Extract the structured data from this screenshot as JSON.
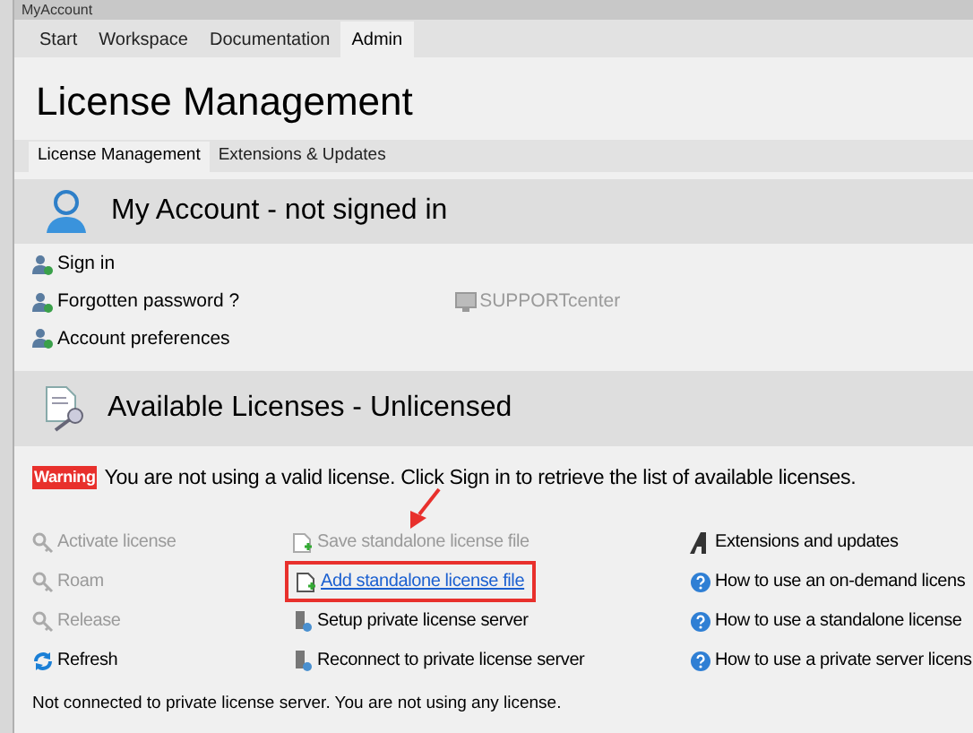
{
  "window": {
    "title": "MyAccount"
  },
  "tabs": [
    {
      "label": "Start",
      "selected": false
    },
    {
      "label": "Workspace",
      "selected": false
    },
    {
      "label": "Documentation",
      "selected": false
    },
    {
      "label": "Admin",
      "selected": true
    }
  ],
  "page_title": "License Management",
  "subtabs": [
    {
      "label": "License Management",
      "selected": true
    },
    {
      "label": "Extensions & Updates",
      "selected": false
    }
  ],
  "account_section": {
    "title": "My Account - not signed in",
    "links": [
      {
        "label": "Sign in",
        "disabled": false
      },
      {
        "label": "Forgotten password ?",
        "disabled": false
      },
      {
        "label": "Account preferences",
        "disabled": false
      }
    ],
    "support": {
      "label": "SUPPORTcenter",
      "disabled": true
    }
  },
  "licenses_section": {
    "title": "Available Licenses - Unlicensed",
    "warning": {
      "badge": "Warning",
      "text": "You are not using a valid license. Click Sign in to retrieve the list of available licenses."
    },
    "columns": [
      [
        {
          "label": "Activate license",
          "kind": "key",
          "disabled": true,
          "highlighted": false
        },
        {
          "label": "Roam",
          "kind": "key",
          "disabled": true,
          "highlighted": false
        },
        {
          "label": "Release",
          "kind": "key",
          "disabled": true,
          "highlighted": false
        },
        {
          "label": "Refresh",
          "kind": "refresh",
          "disabled": false,
          "highlighted": false
        }
      ],
      [
        {
          "label": "Save standalone license file",
          "kind": "file",
          "disabled": true,
          "highlighted": false
        },
        {
          "label": "Add standalone license file",
          "kind": "file",
          "disabled": false,
          "highlighted": true
        },
        {
          "label": "Setup private license server",
          "kind": "server",
          "disabled": false,
          "highlighted": false
        },
        {
          "label": "Reconnect to private license server",
          "kind": "server",
          "disabled": false,
          "highlighted": false
        }
      ],
      [
        {
          "label": "Extensions and updates",
          "kind": "logo",
          "disabled": false,
          "highlighted": false
        },
        {
          "label": "How to use an on-demand licens",
          "kind": "help",
          "disabled": false,
          "highlighted": false
        },
        {
          "label": "How to use a standalone license",
          "kind": "help",
          "disabled": false,
          "highlighted": false
        },
        {
          "label": "How to use a private server licens",
          "kind": "help",
          "disabled": false,
          "highlighted": false
        }
      ]
    ],
    "status": "Not connected to private license server. You are not using any license."
  }
}
